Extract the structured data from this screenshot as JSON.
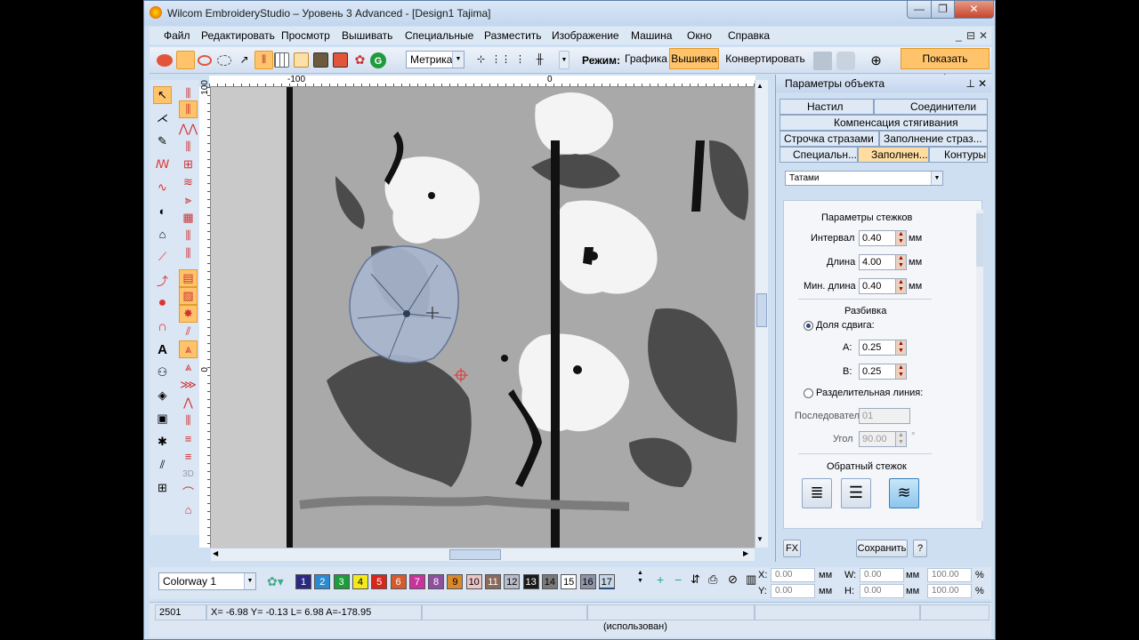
{
  "app": {
    "title": "Wilcom EmbroideryStudio – Уровень 3 Advanced - [Design1          Tajima]",
    "min": "—",
    "max": "❐",
    "close": "✕"
  },
  "menu": [
    "Файл",
    "Редактировать",
    "Просмотр",
    "Вышивать",
    "Специальные",
    "Разместить",
    "Изображение",
    "Машина",
    "Окно",
    "Справка"
  ],
  "mdi_controls": [
    "_",
    "⊟",
    "✕"
  ],
  "toolbar": {
    "units": "Метрика",
    "mode_label": "Режим:",
    "mode_graphics": "Графика",
    "mode_embroidery": "Вышивка",
    "convert": "Конвертировать",
    "show_graphics": "Показать графику"
  },
  "rulers": {
    "h_left": "-100",
    "h_zero": "0",
    "v_top": "100",
    "v_zero": "0"
  },
  "panel": {
    "title": "Параметры объекта",
    "tabs": [
      "Настил",
      "Соединители",
      "Компенсация стягивания",
      "Строчка стразами",
      "Заполнение страз...",
      "Специальн...",
      "Заполнен...",
      "Контуры"
    ],
    "fill_type": "Татами",
    "stitch_params_header": "Параметры стежков",
    "interval_label": "Интервал",
    "interval_value": "0.40",
    "length_label": "Длина",
    "length_value": "4.00",
    "min_length_label": "Мин. длина",
    "min_length_value": "0.40",
    "unit": "мм",
    "split_header": "Разбивка",
    "offset_fraction": "Доля сдвига:",
    "a_label": "A:",
    "a_value": "0.25",
    "b_label": "B:",
    "b_value": "0.25",
    "split_line": "Разделительная линия:",
    "sequence_label": "Последователь",
    "sequence_value": "01",
    "angle_label": "Угол",
    "angle_value": "90.00",
    "degree": "°",
    "back_stitch_header": "Обратный стежок",
    "fx": "FX",
    "save": "Сохранить",
    "help": "?"
  },
  "colorbar": {
    "colorway": "Colorway 1",
    "swatches": [
      {
        "n": "1",
        "bg": "#2b2a82",
        "fg": "#ffffff"
      },
      {
        "n": "2",
        "bg": "#2a8bd0",
        "fg": "#ffffff"
      },
      {
        "n": "3",
        "bg": "#1e9b3c",
        "fg": "#ffffff"
      },
      {
        "n": "4",
        "bg": "#f2ea1a",
        "fg": "#000000"
      },
      {
        "n": "5",
        "bg": "#d9261c",
        "fg": "#ffffff"
      },
      {
        "n": "6",
        "bg": "#d45b2f",
        "fg": "#ffffff"
      },
      {
        "n": "7",
        "bg": "#c9339a",
        "fg": "#ffffff"
      },
      {
        "n": "8",
        "bg": "#8e4f9e",
        "fg": "#ffffff"
      },
      {
        "n": "9",
        "bg": "#d7892b",
        "fg": "#000000"
      },
      {
        "n": "10",
        "bg": "#ecc5c5",
        "fg": "#000000"
      },
      {
        "n": "11",
        "bg": "#8a6a5b",
        "fg": "#ffffff"
      },
      {
        "n": "12",
        "bg": "#b8bcc8",
        "fg": "#000000"
      },
      {
        "n": "13",
        "bg": "#1a1a1a",
        "fg": "#ffffff"
      },
      {
        "n": "14",
        "bg": "#7a7a7a",
        "fg": "#000000"
      },
      {
        "n": "15",
        "bg": "#ffffff",
        "fg": "#000000"
      },
      {
        "n": "16",
        "bg": "#8e93a8",
        "fg": "#000000"
      },
      {
        "n": "17",
        "bg": "#c9d6e6",
        "fg": "#000000"
      }
    ],
    "x_label": "X:",
    "x_value": "0.00",
    "y_label": "Y:",
    "y_value": "0.00",
    "w_label": "W:",
    "w_value": "0.00",
    "h_label": "H:",
    "h_value": "0.00",
    "mm": "мм",
    "pct1": "100.00",
    "pct2": "100.00",
    "pct": "%"
  },
  "status": {
    "stitches": "2501",
    "coords": "X=  -6.98 Y=  -0.13 L=   6.98 A=-178.95",
    "used": "(использован)"
  },
  "colors": {
    "accent": "#ffc46b",
    "window_bg": "#cfe0f3"
  }
}
